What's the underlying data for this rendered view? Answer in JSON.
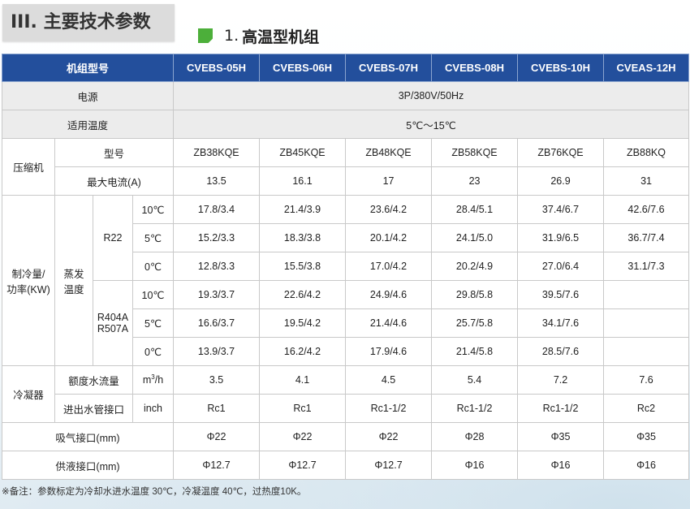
{
  "section": {
    "title": "III. 主要技术参数"
  },
  "subtitle": {
    "num": "1.",
    "text": "高温型机组"
  },
  "table": {
    "header_label": "机组型号",
    "models": [
      "CVEBS-05H",
      "CVEBS-06H",
      "CVEBS-07H",
      "CVEBS-08H",
      "CVEBS-10H",
      "CVEAS-12H"
    ],
    "power": {
      "label": "电源",
      "value": "3P/380V/50Hz"
    },
    "temp_range": {
      "label": "适用温度",
      "value": "5℃～15℃"
    },
    "compressor": {
      "label": "压缩机",
      "model_label": "型号",
      "models": [
        "ZB38KQE",
        "ZB45KQE",
        "ZB48KQE",
        "ZB58KQE",
        "ZB76KQE",
        "ZB88KQ"
      ],
      "current_label": "最大电流(A)",
      "currents": [
        "13.5",
        "16.1",
        "17",
        "23",
        "26.9",
        "31"
      ]
    },
    "cooling": {
      "label_line1": "制冷量/",
      "label_line2": "功率(KW)",
      "evap_line1": "蒸发",
      "evap_line2": "温度",
      "r22": {
        "label": "R22",
        "rows": [
          {
            "temp": "10℃",
            "values": [
              "17.8/3.4",
              "21.4/3.9",
              "23.6/4.2",
              "28.4/5.1",
              "37.4/6.7",
              "42.6/7.6"
            ]
          },
          {
            "temp": "5℃",
            "values": [
              "15.2/3.3",
              "18.3/3.8",
              "20.1/4.2",
              "24.1/5.0",
              "31.9/6.5",
              "36.7/7.4"
            ]
          },
          {
            "temp": "0℃",
            "values": [
              "12.8/3.3",
              "15.5/3.8",
              "17.0/4.2",
              "20.2/4.9",
              "27.0/6.4",
              "31.1/7.3"
            ]
          }
        ]
      },
      "r404a": {
        "label_line1": "R404A",
        "label_line2": "R507A",
        "rows": [
          {
            "temp": "10℃",
            "values": [
              "19.3/3.7",
              "22.6/4.2",
              "24.9/4.6",
              "29.8/5.8",
              "39.5/7.6",
              ""
            ]
          },
          {
            "temp": "5℃",
            "values": [
              "16.6/3.7",
              "19.5/4.2",
              "21.4/4.6",
              "25.7/5.8",
              "34.1/7.6",
              ""
            ]
          },
          {
            "temp": "0℃",
            "values": [
              "13.9/3.7",
              "16.2/4.2",
              "17.9/4.6",
              "21.4/5.8",
              "28.5/7.6",
              ""
            ]
          }
        ]
      }
    },
    "condenser": {
      "label": "冷凝器",
      "flow_label": "额度水流量",
      "flow_unit": "m",
      "flow_unit_sup": "3",
      "flow_unit_tail": "/h",
      "flows": [
        "3.5",
        "4.1",
        "4.5",
        "5.4",
        "7.2",
        "7.6"
      ],
      "pipe_label": "进出水管接口",
      "pipe_unit": "inch",
      "pipes": [
        "Rc1",
        "Rc1",
        "Rc1-1/2",
        "Rc1-1/2",
        "Rc1-1/2",
        "Rc2"
      ]
    },
    "suction": {
      "label": "吸气接口(mm)",
      "values": [
        "Φ22",
        "Φ22",
        "Φ22",
        "Φ28",
        "Φ35",
        "Φ35"
      ]
    },
    "liquid": {
      "label": "供液接口(mm)",
      "values": [
        "Φ12.7",
        "Φ12.7",
        "Φ12.7",
        "Φ16",
        "Φ16",
        "Φ16"
      ]
    }
  },
  "note": "※备注：参数标定为冷却水进水温度 30℃，冷凝温度 40℃，过热度10K。"
}
